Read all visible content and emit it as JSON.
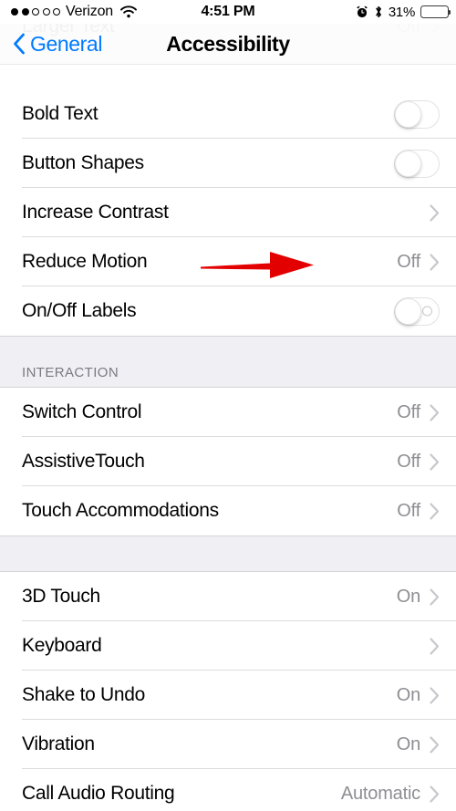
{
  "status_bar": {
    "signal_dots_filled": 2,
    "signal_dots_total": 5,
    "carrier": "Verizon",
    "wifi_icon": "wifi-icon",
    "time": "4:51 PM",
    "alarm_icon": "alarm-clock-icon",
    "bluetooth_icon": "bluetooth-icon",
    "battery_percent": "31%",
    "battery_level": 31,
    "battery_color": "#f5c518"
  },
  "nav_bar": {
    "back_label": "General",
    "back_icon": "chevron-left-icon",
    "title": "Accessibility",
    "tint_color": "#007aff"
  },
  "colors": {
    "accent": "#007aff",
    "value_text": "#8e8e93",
    "section_bg": "#efeff4",
    "separator": "#dcdcdc",
    "chevron": "#c7c7cc",
    "annotation_arrow": "#e30000"
  },
  "sections": [
    {
      "id": "vision-continued",
      "header": "",
      "rows": [
        {
          "label": "Larger Text",
          "value": "Off",
          "accessory": "chevron",
          "clipped": true
        },
        {
          "label": "Bold Text",
          "value": "",
          "accessory": "toggle",
          "toggle_on": false,
          "toggle_labels": false
        },
        {
          "label": "Button Shapes",
          "value": "",
          "accessory": "toggle",
          "toggle_on": false,
          "toggle_labels": false
        },
        {
          "label": "Increase Contrast",
          "value": "",
          "accessory": "chevron"
        },
        {
          "label": "Reduce Motion",
          "value": "Off",
          "accessory": "chevron",
          "annotated": true
        },
        {
          "label": "On/Off Labels",
          "value": "",
          "accessory": "toggle",
          "toggle_on": false,
          "toggle_labels": true
        }
      ]
    },
    {
      "id": "interaction",
      "header": "INTERACTION",
      "rows": [
        {
          "label": "Switch Control",
          "value": "Off",
          "accessory": "chevron"
        },
        {
          "label": "AssistiveTouch",
          "value": "Off",
          "accessory": "chevron"
        },
        {
          "label": "Touch Accommodations",
          "value": "Off",
          "accessory": "chevron"
        }
      ]
    },
    {
      "id": "physical-motor",
      "header": "",
      "rows": [
        {
          "label": "3D Touch",
          "value": "On",
          "accessory": "chevron"
        },
        {
          "label": "Keyboard",
          "value": "",
          "accessory": "chevron"
        },
        {
          "label": "Shake to Undo",
          "value": "On",
          "accessory": "chevron"
        },
        {
          "label": "Vibration",
          "value": "On",
          "accessory": "chevron"
        },
        {
          "label": "Call Audio Routing",
          "value": "Automatic",
          "accessory": "chevron",
          "clipped_bottom": true
        }
      ]
    }
  ]
}
